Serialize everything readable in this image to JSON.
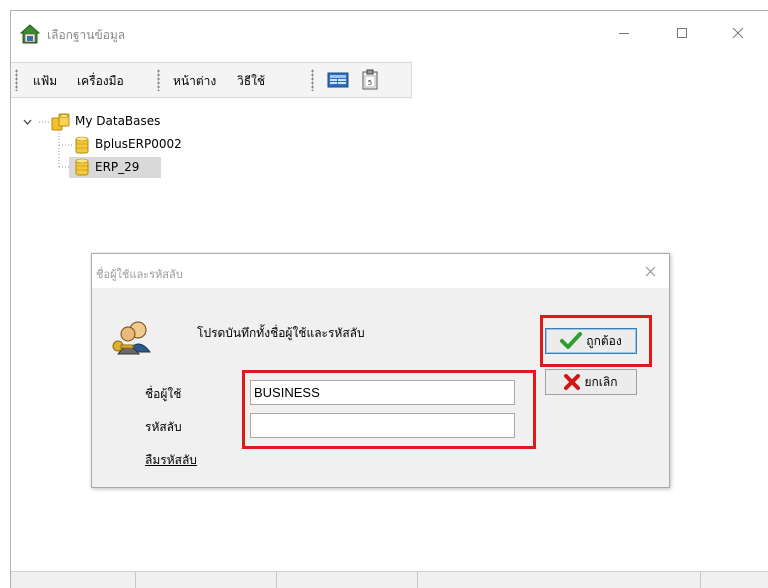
{
  "window": {
    "title": "เลือกฐานข้อมูล",
    "controls": {
      "minimize": "minimize-icon",
      "maximize": "maximize-icon",
      "close": "close-icon"
    }
  },
  "menubar": {
    "items": [
      "แฟ้ม",
      "เครื่องมือ",
      "หน้าต่าง",
      "วิธีใช้"
    ],
    "tools": [
      "database-icon",
      "clipboard-icon"
    ]
  },
  "tree": {
    "root": "My DataBases",
    "children": [
      "BplusERP0002",
      "ERP_29"
    ],
    "selected": "ERP_29"
  },
  "dialog": {
    "title": "ชื่อผู้ใช้และรหัสลับ",
    "prompt": "โปรดบันทึกทั้งชื่อผู้ใช้และรหัสลับ",
    "username_label": "ชื่อผู้ใช้",
    "username_value": "BUSINESS",
    "password_label": "รหัสลับ",
    "password_value": "",
    "forgot_label": "ลืมรหัสลับ",
    "ok_label": "ถูกต้อง",
    "cancel_label": "ยกเลิก"
  },
  "colors": {
    "highlight": "#e01a1a",
    "ok_check": "#2e9e2e",
    "cancel_x": "#d01818",
    "selection": "#d9d9d9"
  }
}
